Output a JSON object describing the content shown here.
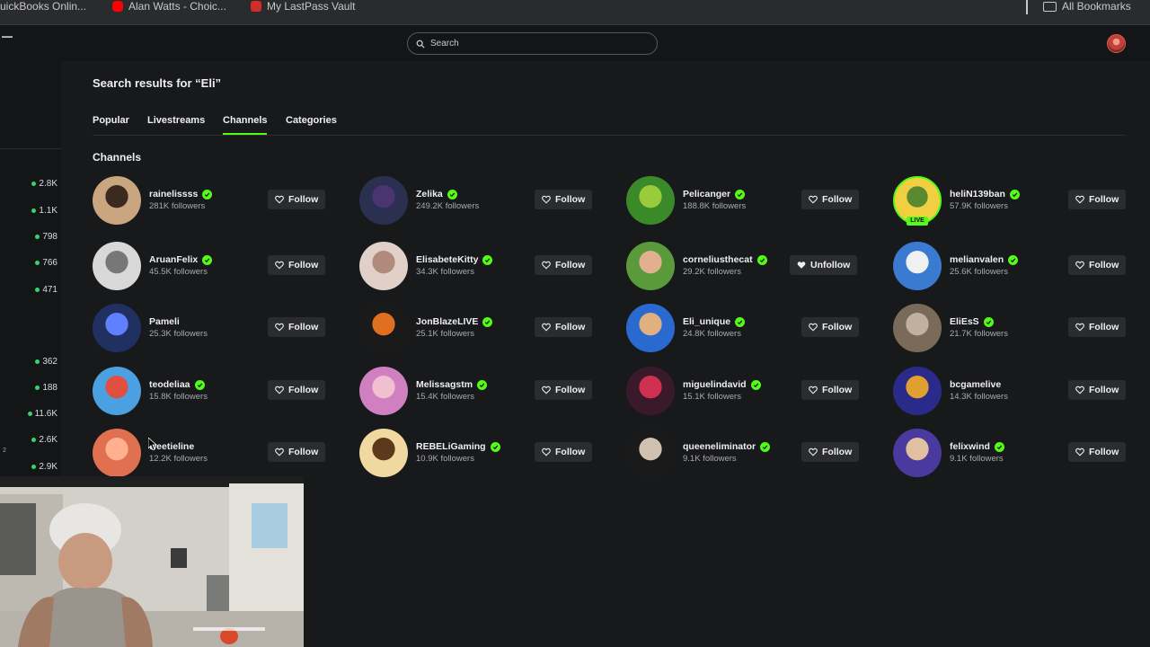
{
  "bookmarks": {
    "items": [
      {
        "label": "uickBooks Onlin...",
        "icon": "quickbooks-icon",
        "color": "#2ca01c"
      },
      {
        "label": "Alan Watts - Choic...",
        "icon": "youtube-icon",
        "color": "#ff0000"
      },
      {
        "label": "My LastPass Vault",
        "icon": "lastpass-icon",
        "color": "#d32d27"
      }
    ],
    "all_label": "All Bookmarks"
  },
  "header": {
    "search_placeholder": "Search"
  },
  "sidebar": {
    "counts": [
      "2.8K",
      "1.1K",
      "798",
      "766",
      "471",
      "362",
      "188",
      "11.6K",
      "2.6K",
      "2.9K"
    ],
    "small_marker": "2"
  },
  "main": {
    "title": "Search results for “Eli”",
    "tabs": [
      "Popular",
      "Livestreams",
      "Channels",
      "Categories"
    ],
    "active_tab": "Channels",
    "section_title": "Channels"
  },
  "channels": [
    {
      "name": "rainelissss",
      "followers": "281K followers",
      "action": "Follow",
      "verified": true
    },
    {
      "name": "Zelika",
      "followers": "249.2K followers",
      "action": "Follow",
      "verified": true
    },
    {
      "name": "Pelicanger",
      "followers": "188.8K followers",
      "action": "Follow",
      "verified": true
    },
    {
      "name": "heliN139ban",
      "followers": "57.9K followers",
      "action": "Follow",
      "verified": true,
      "live": true,
      "live_label": "LIVE"
    },
    {
      "name": "AruanFelix",
      "followers": "45.5K followers",
      "action": "Follow",
      "verified": true
    },
    {
      "name": "ElisabeteKitty",
      "followers": "34.3K followers",
      "action": "Follow",
      "verified": true
    },
    {
      "name": "corneliusthecat",
      "followers": "29.2K followers",
      "action": "Unfollow",
      "verified": true
    },
    {
      "name": "melianvalen",
      "followers": "25.6K followers",
      "action": "Follow",
      "verified": true
    },
    {
      "name": "Pameli",
      "followers": "25.3K followers",
      "action": "Follow",
      "verified": false
    },
    {
      "name": "JonBlazeLIVE",
      "followers": "25.1K followers",
      "action": "Follow",
      "verified": true
    },
    {
      "name": "Eli_unique",
      "followers": "24.8K followers",
      "action": "Follow",
      "verified": true
    },
    {
      "name": "EliEsS",
      "followers": "21.7K followers",
      "action": "Follow",
      "verified": true
    },
    {
      "name": "teodeliaa",
      "followers": "15.8K followers",
      "action": "Follow",
      "verified": true
    },
    {
      "name": "Melissagstm",
      "followers": "15.4K followers",
      "action": "Follow",
      "verified": true
    },
    {
      "name": "miguelindavid",
      "followers": "15.1K followers",
      "action": "Follow",
      "verified": true
    },
    {
      "name": "bcgamelive",
      "followers": "14.3K followers",
      "action": "Follow",
      "verified": false
    },
    {
      "name": "weetieline",
      "followers": "12.2K followers",
      "action": "Follow",
      "verified": false
    },
    {
      "name": "REBELiGaming",
      "followers": "10.9K followers",
      "action": "Follow",
      "verified": true
    },
    {
      "name": "queeneliminator",
      "followers": "9.1K followers",
      "action": "Follow",
      "verified": true
    },
    {
      "name": "felixwind",
      "followers": "9.1K followers",
      "action": "Follow",
      "verified": true
    }
  ],
  "colors": {
    "accent": "#53fc18",
    "background": "#18191b",
    "button": "#2b2c2f"
  }
}
